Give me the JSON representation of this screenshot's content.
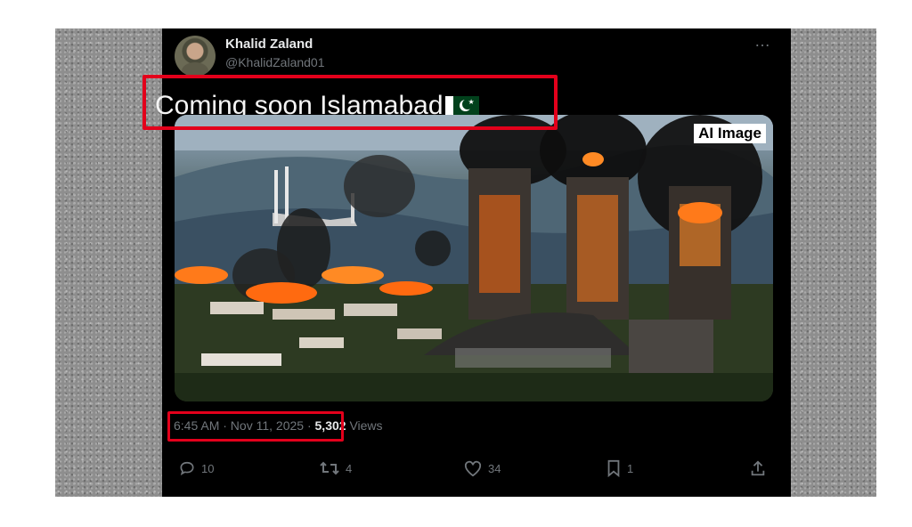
{
  "tweet": {
    "author_name": "Khalid Zaland",
    "author_handle": "@KhalidZaland01",
    "more_icon": "…",
    "text": "Coming soon Islamabad",
    "media_label": "AI Image",
    "timestamp": "6:45 AM · Nov 11, 2025",
    "separator": " · ",
    "views_count": "5,302",
    "views_label": "Views",
    "actions": {
      "replies": "10",
      "reposts": "4",
      "likes": "34",
      "bookmarks": "1"
    }
  },
  "colors": {
    "highlight": "#e3001b",
    "background": "#000000",
    "muted_text": "#71767b"
  },
  "icons": [
    "reply-icon",
    "repost-icon",
    "like-icon",
    "bookmark-icon",
    "share-icon",
    "more-icon",
    "pakistan-flag-emoji"
  ]
}
